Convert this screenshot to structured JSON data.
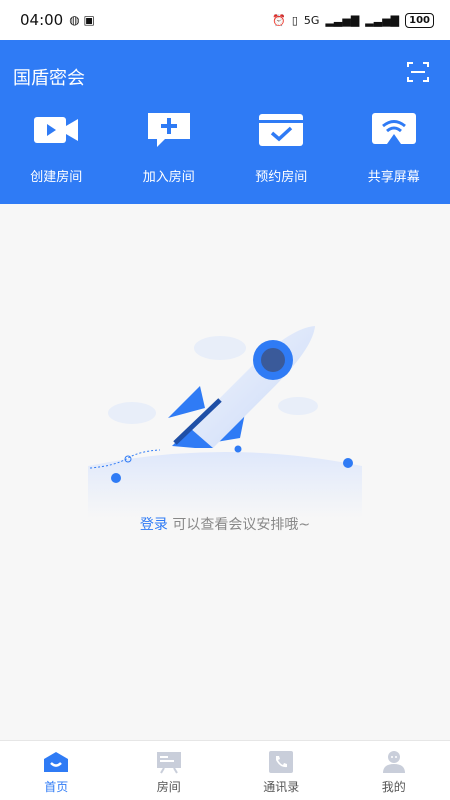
{
  "status_bar": {
    "time": "04:00",
    "network": "5G",
    "battery": "100"
  },
  "header": {
    "title": "国盾密会",
    "scan_icon": "scan-icon"
  },
  "actions": [
    {
      "label": "创建房间",
      "icon": "video-camera-icon"
    },
    {
      "label": "加入房间",
      "icon": "add-chat-icon"
    },
    {
      "label": "预约房间",
      "icon": "calendar-check-icon"
    },
    {
      "label": "共享屏幕",
      "icon": "screen-cast-icon"
    }
  ],
  "empty_state": {
    "login_link": "登录",
    "message": " 可以查看会议安排哦~"
  },
  "tabbar": {
    "tabs": [
      {
        "label": "首页",
        "icon": "home-icon",
        "active": true
      },
      {
        "label": "房间",
        "icon": "room-board-icon",
        "active": false
      },
      {
        "label": "通讯录",
        "icon": "phone-book-icon",
        "active": false
      },
      {
        "label": "我的",
        "icon": "person-icon",
        "active": false
      }
    ]
  },
  "colors": {
    "primary": "#2f7bf5",
    "background": "#f7f7f7"
  }
}
